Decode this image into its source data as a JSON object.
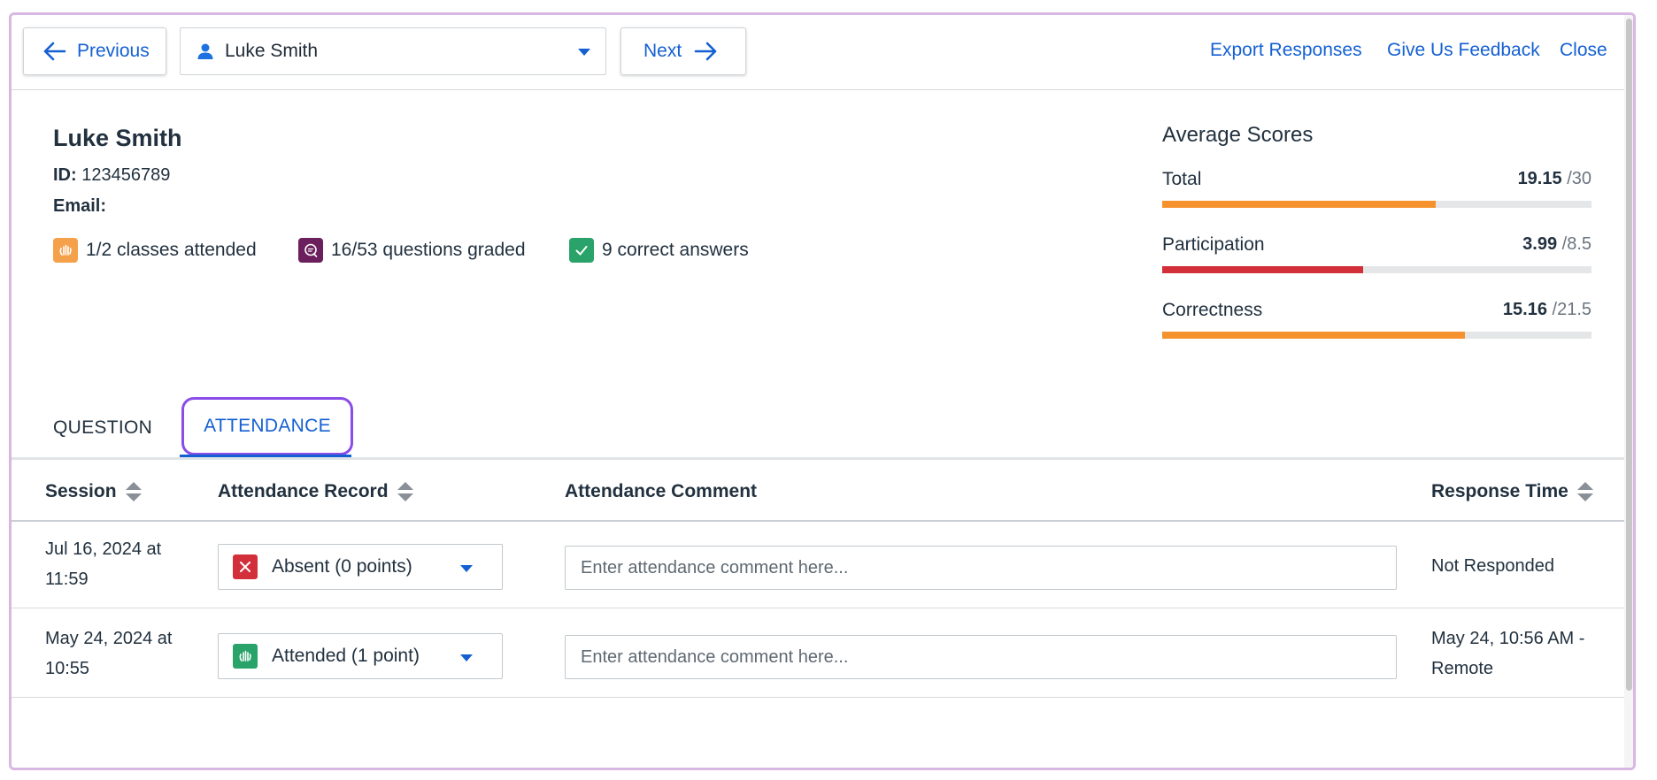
{
  "nav": {
    "previous_label": "Previous",
    "next_label": "Next",
    "selected_student": "Luke Smith",
    "export_label": "Export Responses",
    "feedback_label": "Give Us Feedback",
    "close_label": "Close"
  },
  "profile": {
    "name": "Luke Smith",
    "id_label": "ID:",
    "id_value": "123456789",
    "email_label": "Email:",
    "email_value": "",
    "stats": [
      {
        "text": "1/2 classes attended",
        "icon": "attendance-hand-icon",
        "color": "#f5a04a"
      },
      {
        "text": "16/53 questions graded",
        "icon": "question-bubble-icon",
        "color": "#6b1f5c"
      },
      {
        "text": "9 correct answers",
        "icon": "checkmark-icon",
        "color": "#2aa36b"
      }
    ]
  },
  "scores": {
    "title": "Average Scores",
    "items": [
      {
        "label": "Total",
        "value": "19.15",
        "max": "/30",
        "fraction": 0.638,
        "color": "#f5922e"
      },
      {
        "label": "Participation",
        "value": "3.99",
        "max": "/8.5",
        "fraction": 0.469,
        "color": "#d32f3a"
      },
      {
        "label": "Correctness",
        "value": "15.16",
        "max": "/21.5",
        "fraction": 0.705,
        "color": "#f5922e"
      }
    ]
  },
  "tabs": {
    "question": "QUESTION",
    "attendance": "ATTENDANCE"
  },
  "table": {
    "headers": {
      "session": "Session",
      "record": "Attendance Record",
      "comment": "Attendance Comment",
      "response_time": "Response Time"
    },
    "comment_placeholder": "Enter attendance comment here...",
    "rows": [
      {
        "session_line1": "Jul 16, 2024 at",
        "session_line2": "11:59",
        "record": "Absent (0 points)",
        "record_icon": "absent-x-icon",
        "record_color": "#d32f3a",
        "response_line1": "Not Responded",
        "response_line2": ""
      },
      {
        "session_line1": "May 24, 2024 at",
        "session_line2": "10:55",
        "record": "Attended (1 point)",
        "record_icon": "attendance-hand-icon",
        "record_color": "#2aa36b",
        "response_line1": "May 24, 10:56 AM -",
        "response_line2": "Remote"
      }
    ]
  },
  "colors": {
    "link": "#1460d2",
    "tab_focus_ring": "#8a4de8"
  }
}
